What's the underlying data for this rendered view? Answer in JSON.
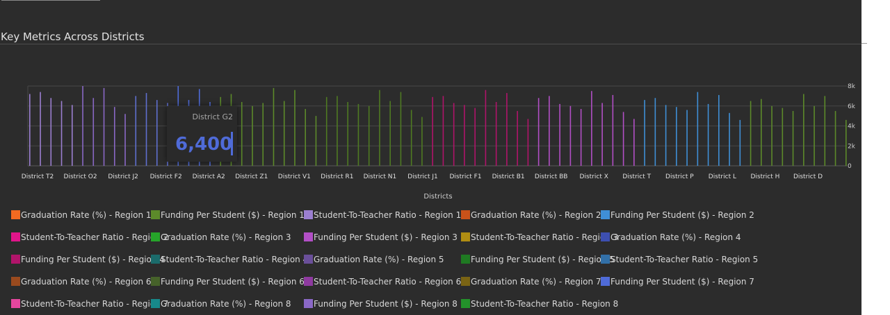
{
  "header": {
    "title": "Key Metrics Across Districts"
  },
  "tooltip": {
    "category": "District G2",
    "value": "6,400",
    "color": "#4f6bd8"
  },
  "chart_data": {
    "type": "bar",
    "title": "Key Metrics Across Districts",
    "xlabel": "Districts",
    "ylabel": "",
    "ylim": [
      0,
      8000
    ],
    "y_ticks": [
      "0",
      "2k",
      "4k",
      "6k",
      "8k"
    ],
    "grid": true,
    "legend_position": "bottom",
    "categories": [
      "District T2",
      "District O2",
      "District J2",
      "District F2",
      "District A2",
      "District Z1",
      "District V1",
      "District R1",
      "District N1",
      "District J1",
      "District F1",
      "District B1",
      "District BB",
      "District X",
      "District T",
      "District P",
      "District L",
      "District H",
      "District D"
    ],
    "series": [
      {
        "name": "Graduation Rate (%) - Region 1",
        "color": "#f26a21"
      },
      {
        "name": "Funding Per Student ($) - Region 1",
        "color": "#5c8a2a"
      },
      {
        "name": "Student-To-Teacher Ratio - Region 1",
        "color": "#9b7fd0"
      },
      {
        "name": "Graduation Rate (%) - Region 2",
        "color": "#c9521a"
      },
      {
        "name": "Funding Per Student ($) - Region 2",
        "color": "#3f8fd6"
      },
      {
        "name": "Student-To-Teacher Ratio - Region 2",
        "color": "#e0158a"
      },
      {
        "name": "Graduation Rate (%) - Region 3",
        "color": "#26a42a"
      },
      {
        "name": "Funding Per Student ($) - Region 3",
        "color": "#b24fc6"
      },
      {
        "name": "Student-To-Teacher Ratio - Region 3",
        "color": "#b08d12"
      },
      {
        "name": "Graduation Rate (%) - Region 4",
        "color": "#3d4fb0"
      },
      {
        "name": "Funding Per Student ($) - Region 4",
        "color": "#b0146a"
      },
      {
        "name": "Student-To-Teacher Ratio - Region 4",
        "color": "#1b6b6b"
      },
      {
        "name": "Graduation Rate (%) - Region 5",
        "color": "#6a4f9a"
      },
      {
        "name": "Funding Per Student ($) - Region 5",
        "color": "#1f7a22"
      },
      {
        "name": "Student-To-Teacher Ratio - Region 5",
        "color": "#3270a8"
      },
      {
        "name": "Graduation Rate (%) - Region 6",
        "color": "#9a4a1e"
      },
      {
        "name": "Funding Per Student ($) - Region 6",
        "color": "#46622a"
      },
      {
        "name": "Student-To-Teacher Ratio - Region 6",
        "color": "#8e3aa0"
      },
      {
        "name": "Graduation Rate (%) - Region 7",
        "color": "#7a6414"
      },
      {
        "name": "Funding Per Student ($) - Region 7",
        "color": "#4f6bd8"
      },
      {
        "name": "Student-To-Teacher Ratio - Region 7",
        "color": "#e6469e"
      },
      {
        "name": "Graduation Rate (%) - Region 8",
        "color": "#17898a"
      },
      {
        "name": "Funding Per Student ($) - Region 8",
        "color": "#8a68c6"
      },
      {
        "name": "Student-To-Teacher Ratio - Region 8",
        "color": "#23922a"
      }
    ],
    "bars": [
      {
        "c": "#9b7fd0",
        "v": [
          7200,
          7400,
          6800,
          6500,
          6100
        ]
      },
      {
        "c": "#8a68c6",
        "v": [
          8000,
          6800,
          7800,
          5900,
          5200
        ]
      },
      {
        "c": "#5f6fcf",
        "v": [
          7000,
          7300,
          6600,
          6300
        ]
      },
      {
        "c": "#4f6bd8",
        "v": [
          8000,
          6600,
          7700,
          6400
        ]
      },
      {
        "c": "#5c8a2a",
        "v": [
          6900,
          7200,
          6400,
          6000,
          6300
        ]
      },
      {
        "c": "#5c8a2a",
        "v": [
          7800,
          6500,
          7600,
          5700,
          5000
        ]
      },
      {
        "c": "#4f7a22",
        "v": [
          6900,
          7000,
          6400,
          6200,
          6000
        ]
      },
      {
        "c": "#4f7a22",
        "v": [
          7600,
          6500,
          7400,
          5600,
          4900
        ]
      },
      {
        "c": "#b0146a",
        "v": [
          6900,
          7000,
          6300,
          6100,
          5800
        ]
      },
      {
        "c": "#b0146a",
        "v": [
          7600,
          6400,
          7300,
          5500,
          4700
        ]
      },
      {
        "c": "#b24fc6",
        "v": [
          6800,
          7000,
          6200,
          6000,
          5700
        ]
      },
      {
        "c": "#b24fc6",
        "v": [
          7500,
          6300,
          7100,
          5400,
          4700
        ]
      },
      {
        "c": "#3f8fd6",
        "v": [
          6600,
          6800,
          6100,
          5900,
          5600
        ]
      },
      {
        "c": "#3f8fd6",
        "v": [
          7400,
          6200,
          7100,
          5300,
          4600
        ]
      },
      {
        "c": "#5c8a2a",
        "v": [
          6500,
          6700,
          6000,
          5800,
          5500
        ]
      },
      {
        "c": "#5c8a2a",
        "v": [
          7200,
          6000,
          7000,
          5500,
          4600
        ]
      }
    ]
  },
  "legend_items": [
    "Graduation Rate (%) - Region 1",
    "Funding Per Student ($) - Region 1",
    "Student-To-Teacher Ratio - Region 1",
    "Graduation Rate (%) - Region 2",
    "Funding Per Student ($) - Region 2",
    "Student-To-Teacher Ratio - Region 2",
    "Graduation Rate (%) - Region 3",
    "Funding Per Student ($) - Region 3",
    "Student-To-Teacher Ratio - Region 3",
    "Graduation Rate (%) - Region 4",
    "Funding Per Student ($) - Region 4",
    "Student-To-Teacher Ratio - Region 4",
    "Graduation Rate (%) - Region 5",
    "Funding Per Student ($) - Region 5",
    "Student-To-Teacher Ratio - Region 5",
    "Graduation Rate (%) - Region 6",
    "Funding Per Student ($) - Region 6",
    "Student-To-Teacher Ratio - Region 6",
    "Graduation Rate (%) - Region 7",
    "Funding Per Student ($) - Region 7",
    "Student-To-Teacher Ratio - Region 7",
    "Graduation Rate (%) - Region 8",
    "Funding Per Student ($) - Region 8",
    "Student-To-Teacher Ratio - Region 8"
  ]
}
